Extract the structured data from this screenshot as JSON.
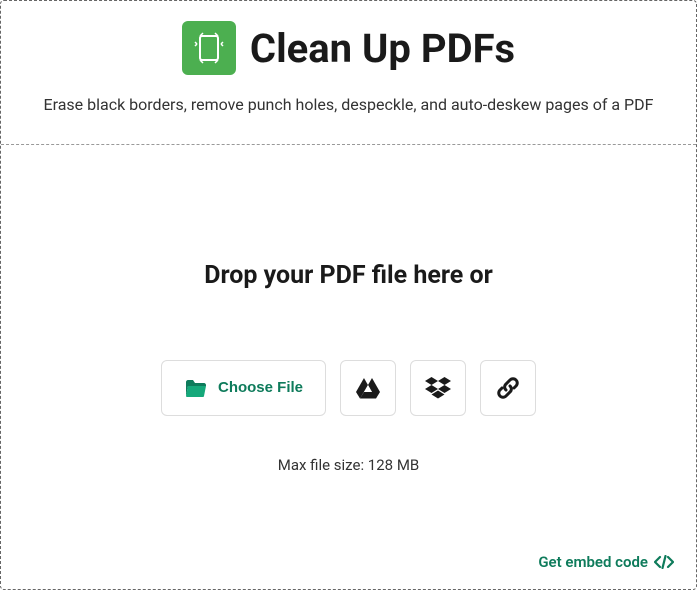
{
  "header": {
    "title": "Clean Up PDFs",
    "subtitle": "Erase black borders, remove punch holes, despeckle, and auto-deskew pages of a PDF"
  },
  "dropzone": {
    "prompt": "Drop your PDF file here or",
    "choose_label": "Choose File",
    "max_size": "Max file size: 128 MB"
  },
  "footer": {
    "embed_label": "Get embed code"
  },
  "icons": {
    "app": "document-cleanup-icon",
    "folder": "folder-open-icon",
    "gdrive": "google-drive-icon",
    "dropbox": "dropbox-icon",
    "link": "link-icon",
    "code": "code-icon"
  },
  "colors": {
    "accent_green": "#4CAF50",
    "text_teal": "#0e7b5b"
  }
}
